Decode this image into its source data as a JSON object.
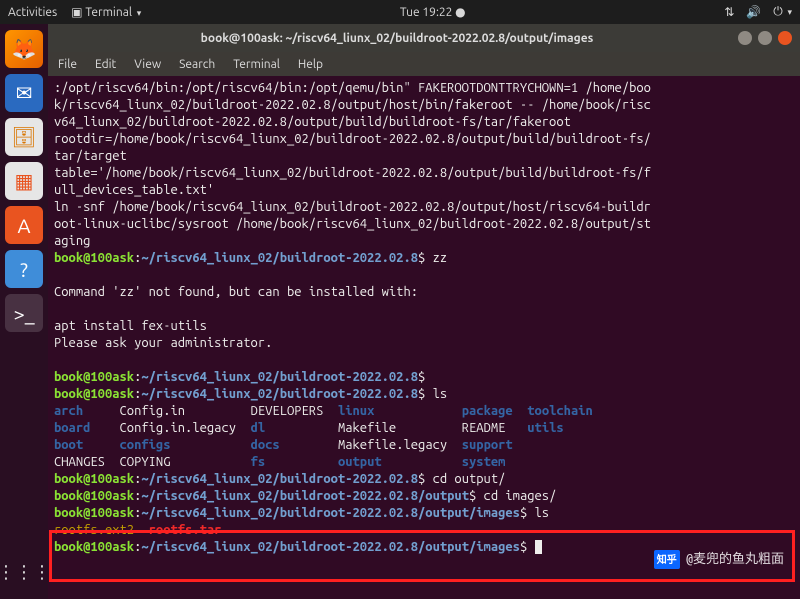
{
  "topbar": {
    "activities": "Activities",
    "app": "Terminal",
    "clock": "Tue 19:22"
  },
  "dock": {
    "items": [
      {
        "name": "firefox-icon"
      },
      {
        "name": "thunderbird-icon"
      },
      {
        "name": "files-icon"
      },
      {
        "name": "software-icon"
      },
      {
        "name": "ubuntu-software-icon"
      },
      {
        "name": "help-icon"
      },
      {
        "name": "terminal-icon"
      }
    ]
  },
  "window": {
    "title": "book@100ask: ~/riscv64_liunx_02/buildroot-2022.02.8/output/images",
    "menu": [
      "File",
      "Edit",
      "View",
      "Search",
      "Terminal",
      "Help"
    ]
  },
  "term": {
    "l1": ":/opt/riscv64/bin:/opt/riscv64/bin:/opt/qemu/bin\" FAKEROOTDONTTRYCHOWN=1 /home/boo",
    "l2": "k/riscv64_liunx_02/buildroot-2022.02.8/output/host/bin/fakeroot -- /home/book/risc",
    "l3": "v64_liunx_02/buildroot-2022.02.8/output/build/buildroot-fs/tar/fakeroot",
    "l4": "rootdir=/home/book/riscv64_liunx_02/buildroot-2022.02.8/output/build/buildroot-fs/",
    "l5": "tar/target",
    "l6": "table='/home/book/riscv64_liunx_02/buildroot-2022.02.8/output/build/buildroot-fs/f",
    "l7": "ull_devices_table.txt'",
    "l8": "ln -snf /home/book/riscv64_liunx_02/buildroot-2022.02.8/output/host/riscv64-buildr",
    "l9": "oot-linux-uclibc/sysroot /home/book/riscv64_liunx_02/buildroot-2022.02.8/output/st",
    "l10": "aging",
    "user": "book@100ask",
    "path1": "~/riscv64_liunx_02/buildroot-2022.02.8",
    "path2": "~/riscv64_liunx_02/buildroot-2022.02.8/output",
    "path3": "~/riscv64_liunx_02/buildroot-2022.02.8/output/images",
    "cmd_zz": "zz",
    "err1": "Command 'zz' not found, but can be installed with:",
    "err2": "apt install fex-utils",
    "err3": "Please ask your administrator.",
    "cmd_ls": "ls",
    "ls_row1": {
      "c1": "arch",
      "c2": "Config.in",
      "c3": "DEVELOPERS",
      "c4": "linux",
      "c5": "package",
      "c6": "toolchain"
    },
    "ls_row2": {
      "c1": "board",
      "c2": "Config.in.legacy",
      "c3": "dl",
      "c4": "Makefile",
      "c5": "README",
      "c6": "utils"
    },
    "ls_row3": {
      "c1": "boot",
      "c2": "configs",
      "c3": "docs",
      "c4": "Makefile.legacy",
      "c5": "support",
      "c6": ""
    },
    "ls_row4": {
      "c1": "CHANGES",
      "c2": "COPYING",
      "c3": "fs",
      "c4": "output",
      "c5": "system",
      "c6": ""
    },
    "cmd_cd1": "cd output/",
    "cmd_cd2": "cd images/",
    "ls2": {
      "c1": "rootfs.ext2",
      "c2": "rootfs.tar"
    }
  },
  "watermark": "@麦兜的鱼丸粗面",
  "zhihu": "知乎"
}
